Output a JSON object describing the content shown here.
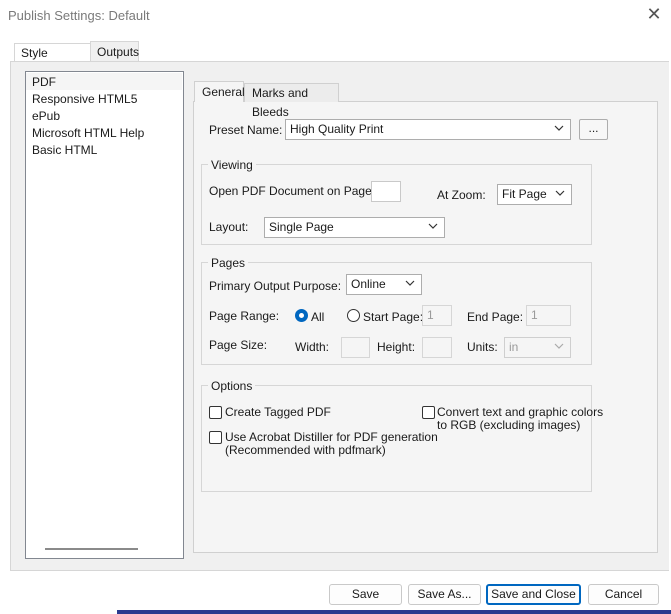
{
  "window": {
    "title": "Publish Settings: Default"
  },
  "top_tabs": [
    {
      "label": "Style Mapping"
    },
    {
      "label": "Outputs"
    }
  ],
  "outputs": [
    "PDF",
    "Responsive HTML5",
    "ePub",
    "Microsoft HTML Help",
    "Basic HTML"
  ],
  "inner_tabs": [
    {
      "label": "General"
    },
    {
      "label": "Marks and Bleeds"
    }
  ],
  "general": {
    "preset_label": "Preset Name:",
    "preset_value": "High Quality Print",
    "browse_label": "...",
    "viewing": {
      "title": "Viewing",
      "open_on_page_label": "Open PDF Document on Page:",
      "open_on_page_value": "",
      "zoom_label": "At Zoom:",
      "zoom_value": "Fit Page",
      "layout_label": "Layout:",
      "layout_value": "Single Page"
    },
    "pages": {
      "title": "Pages",
      "purpose_label": "Primary Output Purpose:",
      "purpose_value": "Online",
      "range_label": "Page Range:",
      "all_label": "All",
      "start_label": "Start Page:",
      "start_value": "1",
      "end_label": "End Page:",
      "end_value": "1",
      "size_label": "Page Size:",
      "width_label": "Width:",
      "height_label": "Height:",
      "units_label": "Units:",
      "units_value": "in"
    },
    "options": {
      "title": "Options",
      "tagged_pdf": "Create Tagged PDF",
      "distiller_line1": "Use Acrobat Distiller for PDF generation",
      "distiller_line2": "(Recommended with pdfmark)",
      "rgb_line1": "Convert text and graphic colors",
      "rgb_line2": "to RGB (excluding images)"
    }
  },
  "footer": {
    "save": "Save",
    "save_as": "Save As...",
    "save_close": "Save and Close",
    "cancel": "Cancel"
  }
}
